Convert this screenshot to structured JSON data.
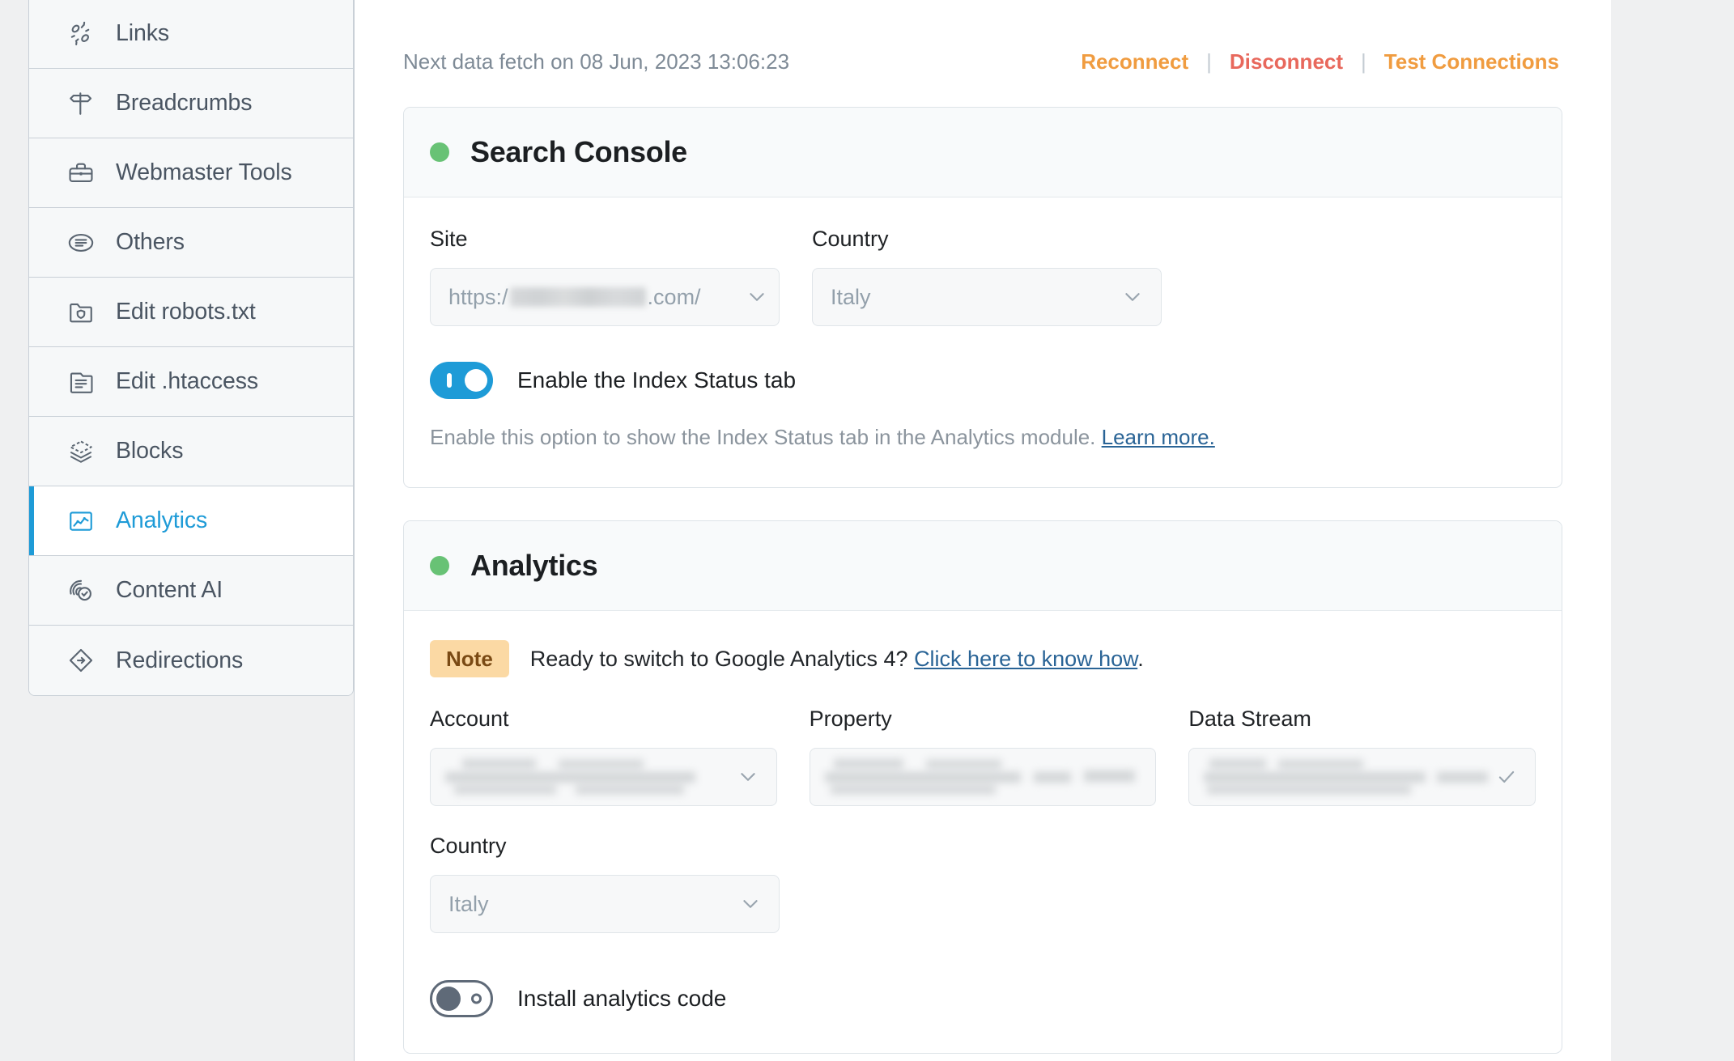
{
  "sidebar": {
    "items": [
      {
        "label": "Links",
        "icon": "links-icon",
        "active": false
      },
      {
        "label": "Breadcrumbs",
        "icon": "signpost-icon",
        "active": false
      },
      {
        "label": "Webmaster Tools",
        "icon": "toolbox-icon",
        "active": false
      },
      {
        "label": "Others",
        "icon": "list-ellipse-icon",
        "active": false
      },
      {
        "label": "Edit robots.txt",
        "icon": "folder-shield-icon",
        "active": false
      },
      {
        "label": "Edit .htaccess",
        "icon": "file-lines-icon",
        "active": false
      },
      {
        "label": "Blocks",
        "icon": "layers-dashed-icon",
        "active": false
      },
      {
        "label": "Analytics",
        "icon": "chart-box-icon",
        "active": true
      },
      {
        "label": "Content AI",
        "icon": "fingerprint-check-icon",
        "active": false
      },
      {
        "label": "Redirections",
        "icon": "diamond-arrow-icon",
        "active": false
      }
    ]
  },
  "header": {
    "fetch_text": "Next data fetch on 08 Jun, 2023 13:06:23",
    "separator": "|",
    "reconnect_label": "Reconnect",
    "disconnect_label": "Disconnect",
    "test_connections_label": "Test Connections"
  },
  "search_console": {
    "title": "Search Console",
    "status_color": "#68c275",
    "site": {
      "label": "Site",
      "value_prefix": "https:/",
      "value_suffix": ".com/",
      "redacted": true
    },
    "country": {
      "label": "Country",
      "value": "Italy"
    },
    "index_status_toggle": {
      "label": "Enable the Index Status tab",
      "state": "on"
    },
    "hint_text": "Enable this option to show the Index Status tab in the Analytics module.",
    "hint_link": "Learn more.",
    "accent_on_color": "#1e9bd7"
  },
  "analytics": {
    "title": "Analytics",
    "status_color": "#68c275",
    "note": {
      "badge": "Note",
      "text_before": "Ready to switch to Google Analytics 4?",
      "link": "Click here to know how",
      "text_after": ".",
      "badge_bg": "#fbd9a4",
      "badge_color": "#7a4a14"
    },
    "account": {
      "label": "Account",
      "value": "",
      "redacted": true
    },
    "property": {
      "label": "Property",
      "value": "",
      "redacted": true
    },
    "data_stream": {
      "label": "Data Stream",
      "value": "",
      "redacted": true
    },
    "country": {
      "label": "Country",
      "value": "Italy"
    },
    "install_code_toggle": {
      "label": "Install analytics code",
      "state": "off"
    }
  }
}
